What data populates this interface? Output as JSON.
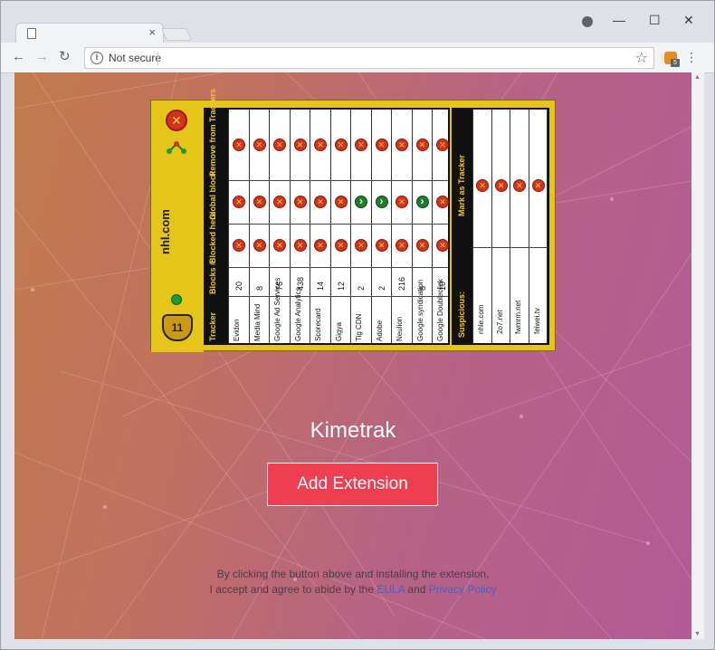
{
  "browser": {
    "tab_close": "×",
    "address_security": "Not secure",
    "ext_badge_count": "5"
  },
  "page": {
    "panel": {
      "site": "nhl.com",
      "shield_label": "11",
      "headers": [
        "Tracker",
        "Blocks #",
        "Blocked here",
        "Global block",
        "Remove from Trackers"
      ],
      "rows": [
        {
          "tracker": "Evidon",
          "blocks": "20",
          "global": "x"
        },
        {
          "tracker": "Media Mind",
          "blocks": "8",
          "global": "x"
        },
        {
          "tracker": "Google Ad Services",
          "blocks": "76",
          "global": "x"
        },
        {
          "tracker": "Google Analytics",
          "blocks": "438",
          "global": "x"
        },
        {
          "tracker": "Scorecard",
          "blocks": "14",
          "global": "x"
        },
        {
          "tracker": "Gigya",
          "blocks": "12",
          "global": "x"
        },
        {
          "tracker": "Tig CDN",
          "blocks": "2",
          "global": "ok"
        },
        {
          "tracker": "Adobe",
          "blocks": "2",
          "global": "ok"
        },
        {
          "tracker": "Neulion",
          "blocks": "216",
          "global": "x"
        },
        {
          "tracker": "Google syndication",
          "blocks": "8",
          "global": "ok"
        },
        {
          "tracker": "Google Doubleclick",
          "blocks": "10",
          "global": "x"
        }
      ],
      "suspicious_header": "Suspicious:",
      "mark_header": "Mark as Tracker",
      "suspicious": [
        "nhle.com",
        "2o7.net",
        "fwmrm.net",
        "feiwei.tv"
      ]
    },
    "extension_name": "Kimetrak",
    "add_button": "Add Extension",
    "disclaimer_line1": "By clicking the button above and installing the extension,",
    "disclaimer_line2_prefix": "I accept and agree to abide by the",
    "eula_link": "EULA",
    "and_text": "and",
    "privacy_link": "Privacy Policy"
  },
  "colors": {
    "button": "#ef3e52",
    "link": "#4062c8",
    "panel_yellow": "#e6c51a"
  }
}
